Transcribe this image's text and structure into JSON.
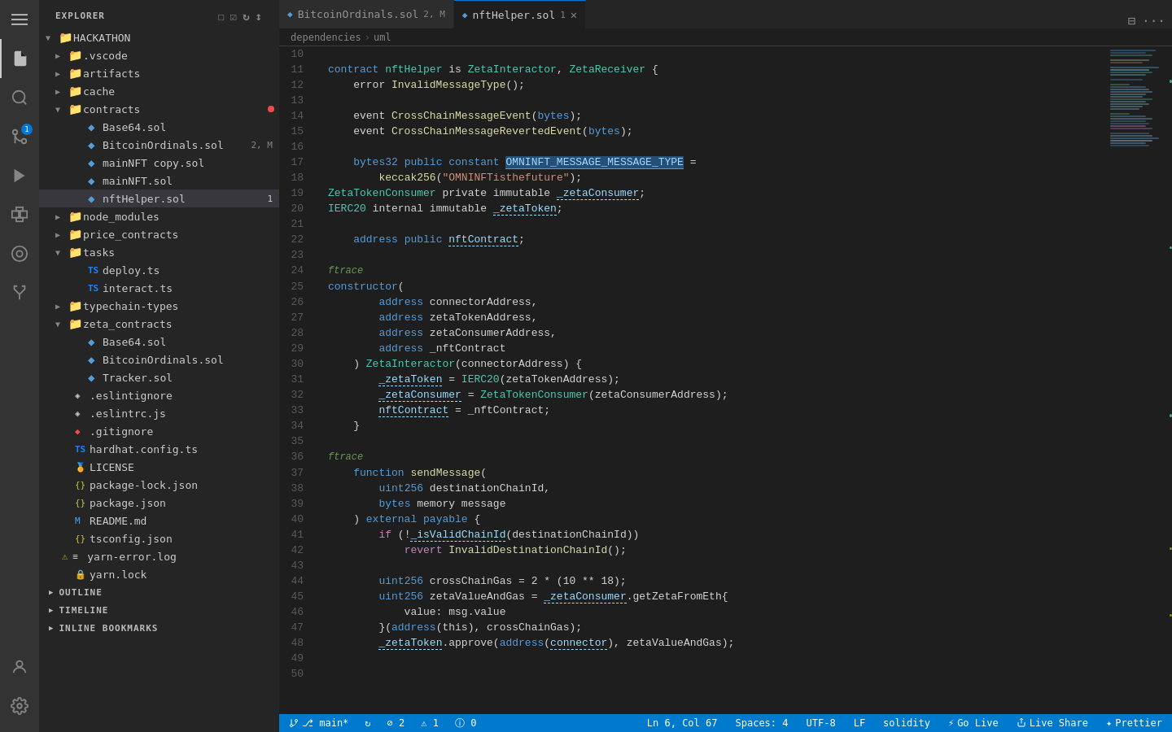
{
  "activityBar": {
    "icons": [
      {
        "name": "menu-icon",
        "symbol": "☰",
        "active": false
      },
      {
        "name": "explorer-icon",
        "symbol": "📄",
        "active": true,
        "label": "Explorer"
      },
      {
        "name": "search-icon",
        "symbol": "🔍",
        "active": false,
        "label": "Search"
      },
      {
        "name": "source-control-icon",
        "symbol": "⑂",
        "active": false,
        "label": "Source Control",
        "badge": "1"
      },
      {
        "name": "run-icon",
        "symbol": "▷",
        "active": false,
        "label": "Run"
      },
      {
        "name": "extensions-icon",
        "symbol": "⊞",
        "active": false,
        "label": "Extensions"
      },
      {
        "name": "remote-icon",
        "symbol": "⊙",
        "active": false,
        "label": "Remote"
      },
      {
        "name": "testing-icon",
        "symbol": "⚗",
        "active": false,
        "label": "Testing"
      }
    ],
    "bottomIcons": [
      {
        "name": "account-icon",
        "symbol": "👤",
        "label": "Account"
      },
      {
        "name": "settings-icon",
        "symbol": "⚙",
        "label": "Settings"
      }
    ]
  },
  "sidebar": {
    "header": "EXPLORER",
    "headerActions": [
      "new-file",
      "new-folder",
      "refresh",
      "collapse"
    ],
    "rootFolder": "HACKATHON",
    "tree": [
      {
        "type": "folder",
        "label": ".vscode",
        "depth": 1,
        "collapsed": true
      },
      {
        "type": "folder",
        "label": "artifacts",
        "depth": 1,
        "collapsed": true
      },
      {
        "type": "folder",
        "label": "cache",
        "depth": 1,
        "collapsed": true
      },
      {
        "type": "folder",
        "label": "contracts",
        "depth": 1,
        "collapsed": false,
        "hasDot": true
      },
      {
        "type": "file",
        "label": "Base64.sol",
        "depth": 2,
        "icon": "sol",
        "color": "#569cd6"
      },
      {
        "type": "file",
        "label": "BitcoinOrdinals.sol",
        "depth": 2,
        "icon": "sol",
        "color": "#569cd6",
        "count": "2, M"
      },
      {
        "type": "file",
        "label": "mainNFT copy.sol",
        "depth": 2,
        "icon": "sol",
        "color": "#569cd6"
      },
      {
        "type": "file",
        "label": "mainNFT.sol",
        "depth": 2,
        "icon": "sol",
        "color": "#569cd6"
      },
      {
        "type": "file",
        "label": "nftHelper.sol",
        "depth": 2,
        "icon": "sol",
        "color": "#569cd6",
        "active": true,
        "count": "1"
      },
      {
        "type": "folder",
        "label": "node_modules",
        "depth": 1,
        "collapsed": true
      },
      {
        "type": "folder",
        "label": "price_contracts",
        "depth": 1,
        "collapsed": true
      },
      {
        "type": "folder",
        "label": "tasks",
        "depth": 1,
        "collapsed": false
      },
      {
        "type": "file",
        "label": "deploy.ts",
        "depth": 2,
        "icon": "ts",
        "color": "#1a85ff"
      },
      {
        "type": "file",
        "label": "interact.ts",
        "depth": 2,
        "icon": "ts",
        "color": "#1a85ff"
      },
      {
        "type": "folder",
        "label": "typechain-types",
        "depth": 1,
        "collapsed": true
      },
      {
        "type": "folder",
        "label": "zeta_contracts",
        "depth": 1,
        "collapsed": false
      },
      {
        "type": "file",
        "label": "Base64.sol",
        "depth": 2,
        "icon": "sol",
        "color": "#569cd6"
      },
      {
        "type": "file",
        "label": "BitcoinOrdinals.sol",
        "depth": 2,
        "icon": "sol",
        "color": "#569cd6"
      },
      {
        "type": "file",
        "label": "Tracker.sol",
        "depth": 2,
        "icon": "sol",
        "color": "#569cd6"
      },
      {
        "type": "file",
        "label": ".eslintignore",
        "depth": 1,
        "icon": "eslint",
        "color": "#cccccc"
      },
      {
        "type": "file",
        "label": ".eslintrc.js",
        "depth": 1,
        "icon": "eslint",
        "color": "#cccccc"
      },
      {
        "type": "file",
        "label": ".gitignore",
        "depth": 1,
        "icon": "git",
        "color": "#cccccc"
      },
      {
        "type": "file",
        "label": "hardhat.config.ts",
        "depth": 1,
        "icon": "ts",
        "color": "#1a85ff"
      },
      {
        "type": "file",
        "label": "LICENSE",
        "depth": 1,
        "icon": "lic",
        "color": "#cccccc"
      },
      {
        "type": "file",
        "label": "package-lock.json",
        "depth": 1,
        "icon": "json",
        "color": "#cbcb41"
      },
      {
        "type": "file",
        "label": "package.json",
        "depth": 1,
        "icon": "json",
        "color": "#cbcb41"
      },
      {
        "type": "file",
        "label": "README.md",
        "depth": 1,
        "icon": "md",
        "color": "#42a5f5"
      },
      {
        "type": "file",
        "label": "tsconfig.json",
        "depth": 1,
        "icon": "json",
        "color": "#cbcb41"
      },
      {
        "type": "file",
        "label": "yarn-error.log",
        "depth": 1,
        "icon": "log",
        "color": "#cccccc",
        "warn": true
      },
      {
        "type": "file",
        "label": "yarn.lock",
        "depth": 1,
        "icon": "yarn",
        "color": "#cccccc"
      }
    ],
    "outlineLabel": "OUTLINE",
    "timelineLabel": "TIMELINE",
    "bookmarksLabel": "INLINE BOOKMARKS"
  },
  "tabs": [
    {
      "label": "BitcoinOrdinals.sol",
      "indicator": "2, M",
      "active": false,
      "hasDot": true
    },
    {
      "label": "nftHelper.sol",
      "indicator": "1",
      "active": true,
      "hasClose": true
    }
  ],
  "breadcrumb": [
    "dependencies",
    "uml"
  ],
  "editor": {
    "filename": "nftHelper.sol",
    "lines": [
      {
        "num": 10,
        "content": ""
      },
      {
        "num": 11,
        "tokens": [
          {
            "t": "kw",
            "v": "contract "
          },
          {
            "t": "tp",
            "v": "nftHelper"
          },
          {
            "t": "plain",
            "v": " is "
          },
          {
            "t": "tp",
            "v": "ZetaInteractor"
          },
          {
            "t": "plain",
            "v": ", "
          },
          {
            "t": "tp",
            "v": "ZetaReceiver"
          },
          {
            "t": "plain",
            "v": " {"
          }
        ]
      },
      {
        "num": 12,
        "tokens": [
          {
            "t": "plain",
            "v": "    error "
          },
          {
            "t": "fn",
            "v": "InvalidMessageType"
          },
          {
            "t": "plain",
            "v": "();"
          }
        ]
      },
      {
        "num": 13,
        "content": ""
      },
      {
        "num": 14,
        "tokens": [
          {
            "t": "plain",
            "v": "    event "
          },
          {
            "t": "fn",
            "v": "CrossChainMessageEvent"
          },
          {
            "t": "plain",
            "v": "("
          },
          {
            "t": "kw",
            "v": "bytes"
          },
          {
            "t": "plain",
            "v": ");"
          }
        ]
      },
      {
        "num": 15,
        "tokens": [
          {
            "t": "plain",
            "v": "    event "
          },
          {
            "t": "fn",
            "v": "CrossChainMessageRevertedEvent"
          },
          {
            "t": "plain",
            "v": "("
          },
          {
            "t": "kw",
            "v": "bytes"
          },
          {
            "t": "plain",
            "v": ");"
          }
        ]
      },
      {
        "num": 16,
        "content": ""
      },
      {
        "num": 17,
        "tokens": [
          {
            "t": "plain",
            "v": "    "
          },
          {
            "t": "kw",
            "v": "bytes32 public constant "
          },
          {
            "t": "vr",
            "v": "OMNINFT_MESSAGE_MESSAGE_TYPE",
            "hl": true
          },
          {
            "t": "plain",
            "v": " ="
          }
        ]
      },
      {
        "num": 18,
        "tokens": [
          {
            "t": "plain",
            "v": "        "
          },
          {
            "t": "fn",
            "v": "keccak256"
          },
          {
            "t": "plain",
            "v": "("
          },
          {
            "t": "str",
            "v": "\"OMNINFTisthefuture\""
          },
          {
            "t": "plain",
            "v": ");"
          }
        ]
      },
      {
        "num": 19,
        "tokens": [
          {
            "t": "tp",
            "v": "ZetaTokenConsumer"
          },
          {
            "t": "plain",
            "v": " private immutable "
          },
          {
            "t": "vr",
            "v": "_zetaConsumer",
            "hl-dash": true
          },
          {
            "t": "plain",
            "v": ";"
          }
        ]
      },
      {
        "num": 20,
        "tokens": [
          {
            "t": "tp",
            "v": "IERC20"
          },
          {
            "t": "plain",
            "v": " internal immutable "
          },
          {
            "t": "vr",
            "v": "_zetaToken",
            "hl-dash": true
          },
          {
            "t": "plain",
            "v": ";"
          }
        ]
      },
      {
        "num": 21,
        "content": ""
      },
      {
        "num": 22,
        "tokens": [
          {
            "t": "plain",
            "v": "    "
          },
          {
            "t": "kw",
            "v": "address"
          },
          {
            "t": "plain",
            "v": " "
          },
          {
            "t": "kw",
            "v": "public"
          },
          {
            "t": "plain",
            "v": " "
          },
          {
            "t": "vr",
            "v": "nftContract",
            "hl-dash": true
          },
          {
            "t": "plain",
            "v": ";"
          }
        ]
      },
      {
        "num": 23,
        "content": ""
      },
      {
        "num": 24,
        "comment": "ftrace"
      },
      {
        "num": 25,
        "tokens": [
          {
            "t": "kw",
            "v": "constructor"
          },
          {
            "t": "plain",
            "v": "("
          }
        ]
      },
      {
        "num": 26,
        "tokens": [
          {
            "t": "plain",
            "v": "        "
          },
          {
            "t": "kw",
            "v": "address"
          },
          {
            "t": "plain",
            "v": " connectorAddress,"
          }
        ]
      },
      {
        "num": 27,
        "tokens": [
          {
            "t": "plain",
            "v": "        "
          },
          {
            "t": "kw",
            "v": "address"
          },
          {
            "t": "plain",
            "v": " zetaTokenAddress,"
          }
        ]
      },
      {
        "num": 28,
        "tokens": [
          {
            "t": "plain",
            "v": "        "
          },
          {
            "t": "kw",
            "v": "address"
          },
          {
            "t": "plain",
            "v": " zetaConsumerAddress,"
          }
        ]
      },
      {
        "num": 29,
        "tokens": [
          {
            "t": "plain",
            "v": "        "
          },
          {
            "t": "kw",
            "v": "address"
          },
          {
            "t": "plain",
            "v": " _nftContract"
          }
        ]
      },
      {
        "num": 30,
        "tokens": [
          {
            "t": "plain",
            "v": "    ) "
          },
          {
            "t": "tp",
            "v": "ZetaInteractor"
          },
          {
            "t": "plain",
            "v": "(connectorAddress) {"
          }
        ]
      },
      {
        "num": 31,
        "tokens": [
          {
            "t": "plain",
            "v": "        "
          },
          {
            "t": "vr",
            "v": "_zetaToken",
            "hl-dash": true
          },
          {
            "t": "plain",
            "v": " = "
          },
          {
            "t": "tp",
            "v": "IERC20"
          },
          {
            "t": "plain",
            "v": "(zetaTokenAddress);"
          }
        ]
      },
      {
        "num": 32,
        "tokens": [
          {
            "t": "plain",
            "v": "        "
          },
          {
            "t": "vr",
            "v": "_zetaConsumer",
            "hl-dash": true
          },
          {
            "t": "plain",
            "v": " = "
          },
          {
            "t": "tp",
            "v": "ZetaTokenConsumer"
          },
          {
            "t": "plain",
            "v": "(zetaConsumerAddress);"
          }
        ]
      },
      {
        "num": 33,
        "tokens": [
          {
            "t": "plain",
            "v": "        "
          },
          {
            "t": "vr",
            "v": "nftContract",
            "hl-dash": true
          },
          {
            "t": "plain",
            "v": " = _nftContract;"
          }
        ]
      },
      {
        "num": 34,
        "tokens": [
          {
            "t": "plain",
            "v": "    }"
          }
        ]
      },
      {
        "num": 35,
        "content": ""
      },
      {
        "num": 36,
        "comment": "ftrace"
      },
      {
        "num": 37,
        "tokens": [
          {
            "t": "plain",
            "v": "    "
          },
          {
            "t": "kw",
            "v": "function"
          },
          {
            "t": "plain",
            "v": " "
          },
          {
            "t": "fn",
            "v": "sendMessage"
          },
          {
            "t": "plain",
            "v": "("
          }
        ]
      },
      {
        "num": 38,
        "tokens": [
          {
            "t": "plain",
            "v": "        "
          },
          {
            "t": "kw",
            "v": "uint256"
          },
          {
            "t": "plain",
            "v": " destinationChainId,"
          }
        ]
      },
      {
        "num": 39,
        "tokens": [
          {
            "t": "plain",
            "v": "        "
          },
          {
            "t": "kw",
            "v": "bytes"
          },
          {
            "t": "plain",
            "v": " memory message"
          }
        ]
      },
      {
        "num": 40,
        "tokens": [
          {
            "t": "plain",
            "v": "    ) "
          },
          {
            "t": "kw",
            "v": "external"
          },
          {
            "t": "plain",
            "v": " "
          },
          {
            "t": "kw",
            "v": "payable"
          },
          {
            "t": "plain",
            "v": " {"
          }
        ]
      },
      {
        "num": 41,
        "tokens": [
          {
            "t": "plain",
            "v": "        "
          },
          {
            "t": "kw2",
            "v": "if"
          },
          {
            "t": "plain",
            "v": " (!"
          },
          {
            "t": "vr",
            "v": "_isValidChainId",
            "hl-dash": true
          },
          {
            "t": "plain",
            "v": "(destinationChainId))"
          }
        ]
      },
      {
        "num": 42,
        "tokens": [
          {
            "t": "plain",
            "v": "            "
          },
          {
            "t": "kw2",
            "v": "revert"
          },
          {
            "t": "plain",
            "v": " "
          },
          {
            "t": "fn",
            "v": "InvalidDestinationChainId"
          },
          {
            "t": "plain",
            "v": "();"
          }
        ]
      },
      {
        "num": 43,
        "content": ""
      },
      {
        "num": 44,
        "tokens": [
          {
            "t": "plain",
            "v": "        "
          },
          {
            "t": "kw",
            "v": "uint256"
          },
          {
            "t": "plain",
            "v": " crossChainGas = 2 * (10 ** 18);"
          }
        ]
      },
      {
        "num": 45,
        "tokens": [
          {
            "t": "plain",
            "v": "        "
          },
          {
            "t": "kw",
            "v": "uint256"
          },
          {
            "t": "plain",
            "v": " zetaValueAndGas = "
          },
          {
            "t": "vr",
            "v": "_zetaConsumer",
            "hl-dash": true
          },
          {
            "t": "plain",
            "v": ".getZetaFromEth{"
          }
        ]
      },
      {
        "num": 46,
        "tokens": [
          {
            "t": "plain",
            "v": "            value: msg.value"
          }
        ]
      },
      {
        "num": 47,
        "tokens": [
          {
            "t": "plain",
            "v": "        }("
          },
          {
            "t": "kw",
            "v": "address"
          },
          {
            "t": "plain",
            "v": "(this), crossChainGas);"
          }
        ]
      },
      {
        "num": 48,
        "tokens": [
          {
            "t": "plain",
            "v": "        "
          },
          {
            "t": "vr",
            "v": "_zetaToken",
            "hl-dash": true
          },
          {
            "t": "plain",
            "v": ".approve("
          },
          {
            "t": "kw",
            "v": "address"
          },
          {
            "t": "plain",
            "v": "("
          },
          {
            "t": "vr",
            "v": "connector",
            "hl-dash": true
          },
          {
            "t": "plain",
            "v": "), zetaValueAndGas);"
          }
        ]
      },
      {
        "num": 49,
        "content": ""
      },
      {
        "num": 50,
        "tokens": [
          {
            "t": "plain",
            "v": "        "
          }
        ]
      }
    ]
  },
  "statusBar": {
    "left": [
      {
        "icon": "branch-icon",
        "text": "⎇ main*"
      },
      {
        "icon": "sync-icon",
        "text": "↻"
      },
      {
        "icon": "error-icon",
        "text": "⊘ 2"
      },
      {
        "icon": "warn-icon",
        "text": "⚠ 1"
      },
      {
        "icon": "info-icon",
        "text": "ⓘ 0"
      }
    ],
    "right": [
      {
        "label": "Ln 6, Col 67"
      },
      {
        "label": "Spaces: 4"
      },
      {
        "label": "UTF-8"
      },
      {
        "label": "LF"
      },
      {
        "label": "solidity"
      },
      {
        "label": "Go Live"
      },
      {
        "label": "Live Share"
      }
    ]
  }
}
